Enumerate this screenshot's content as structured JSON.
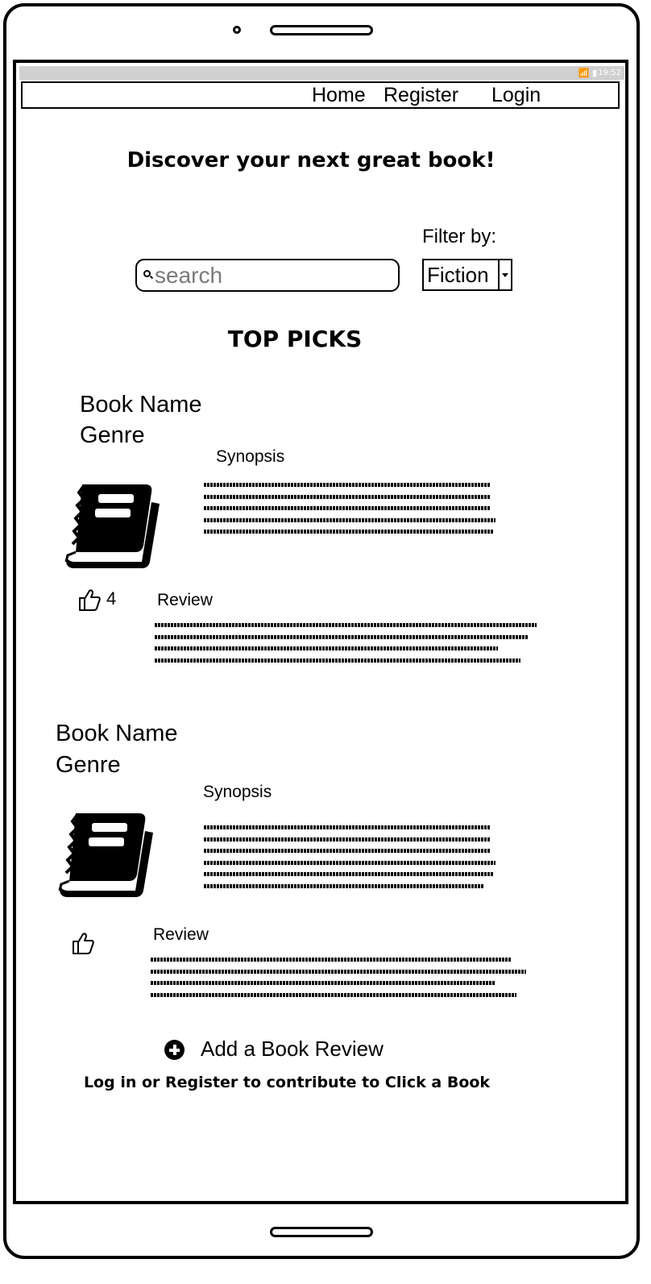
{
  "statusbar": {
    "icons": "📶 ▮",
    "time": "19:52"
  },
  "nav": {
    "home": "Home",
    "register": "Register",
    "login": "Login"
  },
  "heading": "Discover your next great book!",
  "filter": {
    "label": "Filter by:",
    "selected": "Fiction"
  },
  "search": {
    "placeholder": "search"
  },
  "section_title": "TOP PICKS",
  "books": [
    {
      "name": "Book Name",
      "genre": "Genre",
      "synopsis_label": "Synopsis",
      "review_label": "Review",
      "likes": "4"
    },
    {
      "name": "Book Name",
      "genre": "Genre",
      "synopsis_label": "Synopsis",
      "review_label": "Review",
      "likes": ""
    }
  ],
  "add_review": "Add a Book Review",
  "footer_note": "Log in or Register to contribute to Click a Book"
}
